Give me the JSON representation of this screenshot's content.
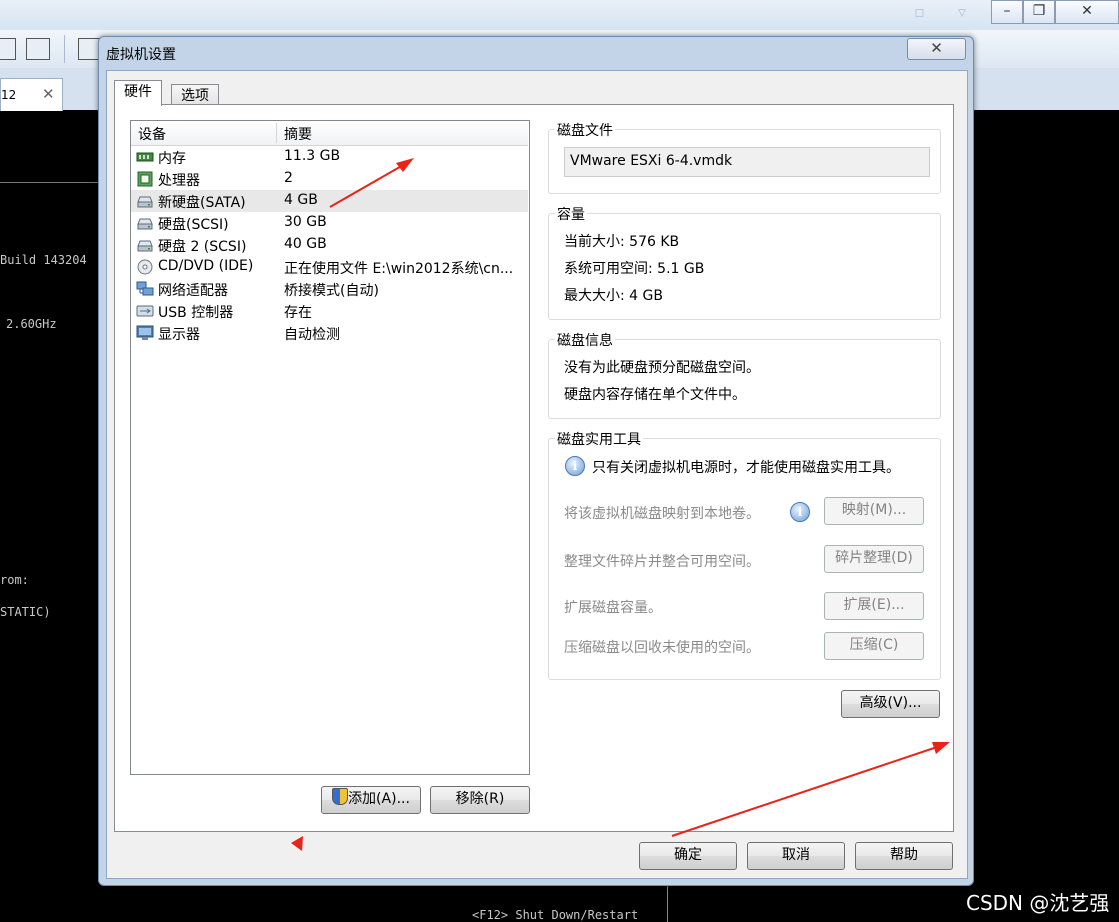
{
  "background": {
    "tab_label": "12",
    "console_lines": [
      "Build 143204",
      "2.60GHz",
      "rom:",
      "STATIC)"
    ],
    "console_footer": "<F12> Shut Down/Restart"
  },
  "dialog": {
    "title": "虚拟机设置",
    "close_glyph": "✕",
    "tabs": [
      "硬件",
      "选项"
    ],
    "device_table": {
      "headers": [
        "设备",
        "摘要"
      ],
      "rows": [
        {
          "name": "内存",
          "summary": "11.3 GB",
          "icon": "memory-icon"
        },
        {
          "name": "处理器",
          "summary": "2",
          "icon": "processor-icon"
        },
        {
          "name": "新硬盘(SATA)",
          "summary": "4 GB",
          "icon": "hard-disk-icon"
        },
        {
          "name": "硬盘(SCSI)",
          "summary": "30 GB",
          "icon": "hard-disk-icon"
        },
        {
          "name": "硬盘 2 (SCSI)",
          "summary": "40 GB",
          "icon": "hard-disk-icon"
        },
        {
          "name": "CD/DVD (IDE)",
          "summary": "正在使用文件 E:\\win2012系统\\cn...",
          "icon": "cd-dvd-icon"
        },
        {
          "name": "网络适配器",
          "summary": "桥接模式(自动)",
          "icon": "network-adapter-icon"
        },
        {
          "name": "USB 控制器",
          "summary": "存在",
          "icon": "usb-icon"
        },
        {
          "name": "显示器",
          "summary": "自动检测",
          "icon": "display-icon"
        }
      ]
    },
    "add_button": "添加(A)...",
    "remove_button": "移除(R)",
    "disk_file": {
      "title": "磁盘文件",
      "value": "VMware ESXi 6-4.vmdk"
    },
    "capacity": {
      "title": "容量",
      "current_size": "当前大小: 576 KB",
      "system_free": "系统可用空间: 5.1 GB",
      "max_size": "最大大小: 4 GB"
    },
    "disk_info": {
      "title": "磁盘信息",
      "line1": "没有为此硬盘预分配磁盘空间。",
      "line2": "硬盘内容存储在单个文件中。"
    },
    "disk_utilities": {
      "title": "磁盘实用工具",
      "note": "只有关闭虚拟机电源时，才能使用磁盘实用工具。",
      "map_text": "将该虚拟机磁盘映射到本地卷。",
      "map_button": "映射(M)...",
      "defrag_text": "整理文件碎片并整合可用空间。",
      "defrag_button": "碎片整理(D)",
      "expand_text": "扩展磁盘容量。",
      "expand_button": "扩展(E)...",
      "compact_text": "压缩磁盘以回收未使用的空间。",
      "compact_button": "压缩(C)"
    },
    "advanced_button": "高级(V)...",
    "ok_button": "确定",
    "cancel_button": "取消",
    "help_button": "帮助"
  },
  "watermark": "CSDN @沈艺强"
}
